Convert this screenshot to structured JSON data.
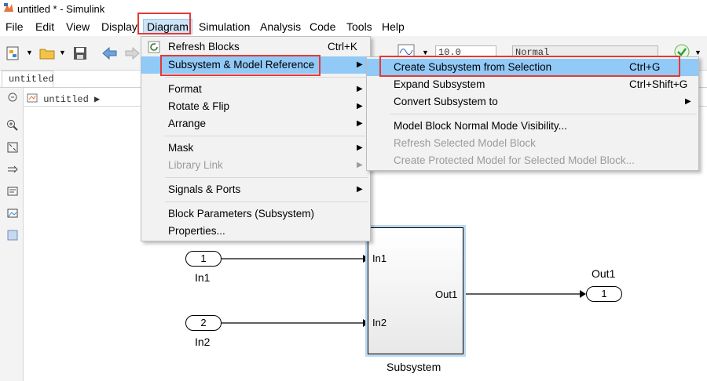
{
  "window": {
    "title": "untitled * - Simulink"
  },
  "menubar": {
    "items": [
      "File",
      "Edit",
      "View",
      "Display",
      "Diagram",
      "Simulation",
      "Analysis",
      "Code",
      "Tools",
      "Help"
    ]
  },
  "toolbar": {
    "stop_time": "10.0",
    "sim_mode": "Normal"
  },
  "tabs": {
    "active": "untitled"
  },
  "breadcrumb": {
    "model": "untitled"
  },
  "diagram_menu": {
    "items": [
      {
        "label": "Refresh Blocks",
        "shortcut": "Ctrl+K"
      },
      {
        "label": "Subsystem & Model Reference"
      },
      {
        "label": "Format"
      },
      {
        "label": "Rotate & Flip"
      },
      {
        "label": "Arrange"
      },
      {
        "label": "Mask"
      },
      {
        "label": "Library Link"
      },
      {
        "label": "Signals & Ports"
      },
      {
        "label": "Block Parameters (Subsystem)"
      },
      {
        "label": "Properties..."
      }
    ]
  },
  "subsystem_menu": {
    "items": [
      {
        "label": "Create Subsystem from Selection",
        "shortcut": "Ctrl+G"
      },
      {
        "label": "Expand Subsystem",
        "shortcut": "Ctrl+Shift+G"
      },
      {
        "label": "Convert Subsystem to"
      },
      {
        "label": "Model Block Normal Mode Visibility..."
      },
      {
        "label": "Refresh Selected Model Block"
      },
      {
        "label": "Create Protected Model for Selected Model Block..."
      }
    ]
  },
  "model": {
    "in1": {
      "number": "1",
      "name": "In1"
    },
    "in2": {
      "number": "2",
      "name": "In2"
    },
    "out1": {
      "number": "1",
      "name": "Out1"
    },
    "subsystem": {
      "name": "Subsystem",
      "port_in1": "In1",
      "port_in2": "In2",
      "port_out1": "Out1"
    }
  },
  "colors": {
    "highlight": "#91c9f7",
    "callout": "#e53935",
    "menu_bg": "#f2f2f2"
  }
}
